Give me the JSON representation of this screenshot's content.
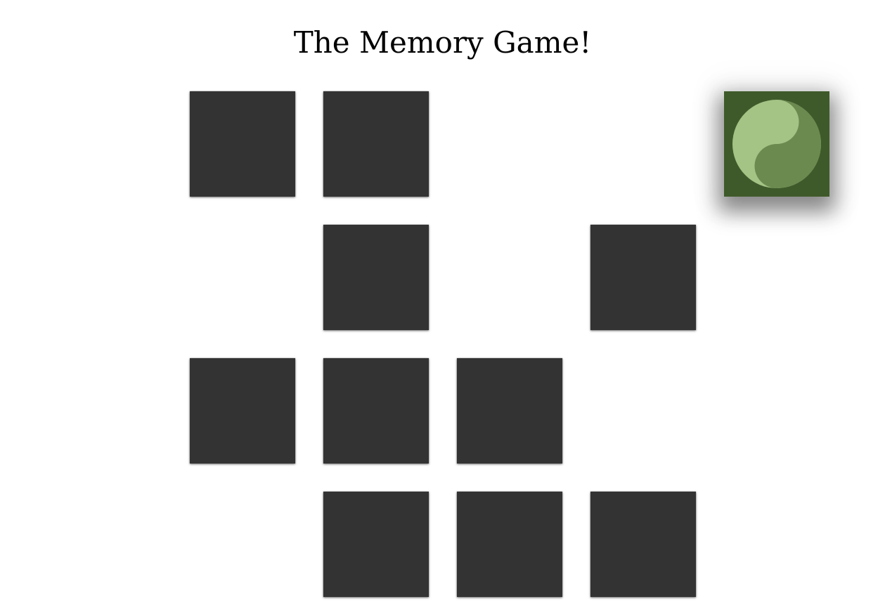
{
  "title": "The Memory Game!",
  "colors": {
    "card_back": "#333333",
    "card_face": "#3f5a2a",
    "yin_light": "#a3c485",
    "yin_dark": "#6b8a4f",
    "background": "#ffffff"
  },
  "cards": [
    {
      "row": 0,
      "col": 0,
      "state": "facedown"
    },
    {
      "row": 0,
      "col": 1,
      "state": "facedown"
    },
    {
      "row": 0,
      "col": 4,
      "state": "faceup",
      "icon": "yin-yang-icon"
    },
    {
      "row": 1,
      "col": 1,
      "state": "facedown"
    },
    {
      "row": 1,
      "col": 3,
      "state": "facedown"
    },
    {
      "row": 2,
      "col": 0,
      "state": "facedown"
    },
    {
      "row": 2,
      "col": 1,
      "state": "facedown"
    },
    {
      "row": 2,
      "col": 2,
      "state": "facedown"
    },
    {
      "row": 3,
      "col": 1,
      "state": "facedown"
    },
    {
      "row": 3,
      "col": 2,
      "state": "facedown"
    },
    {
      "row": 3,
      "col": 3,
      "state": "facedown"
    }
  ]
}
